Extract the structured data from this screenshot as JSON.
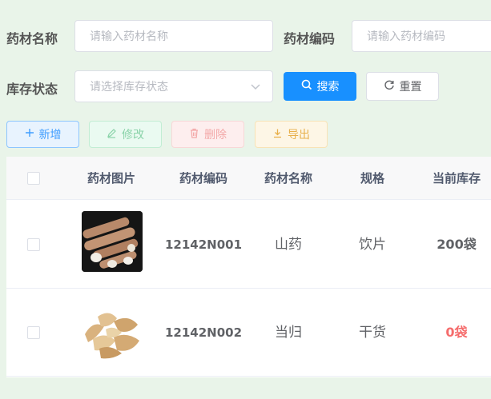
{
  "search_form": {
    "name_label": "药材名称",
    "name_placeholder": "请输入药材名称",
    "code_label": "药材编码",
    "code_placeholder": "请输入药材编码",
    "stock_label": "库存状态",
    "stock_placeholder": "请选择库存状态",
    "search_button": "搜索",
    "reset_button": "重置"
  },
  "toolbar": {
    "add": "新增",
    "edit": "修改",
    "delete": "删除",
    "export": "导出"
  },
  "table": {
    "columns": [
      "药材图片",
      "药材编码",
      "药材名称",
      "规格",
      "当前库存"
    ],
    "rows": [
      {
        "image": "yam-root-photo",
        "code": "12142N001",
        "name": "山药",
        "spec": "饮片",
        "stock": "200袋"
      },
      {
        "image": "angelica-slices-photo",
        "code": "12142N002",
        "name": "当归",
        "spec": "干货",
        "stock": "0袋"
      }
    ]
  },
  "colors": {
    "primary": "#1890ff",
    "danger_text": "#f56c6c",
    "background": "#e9f4e9"
  }
}
